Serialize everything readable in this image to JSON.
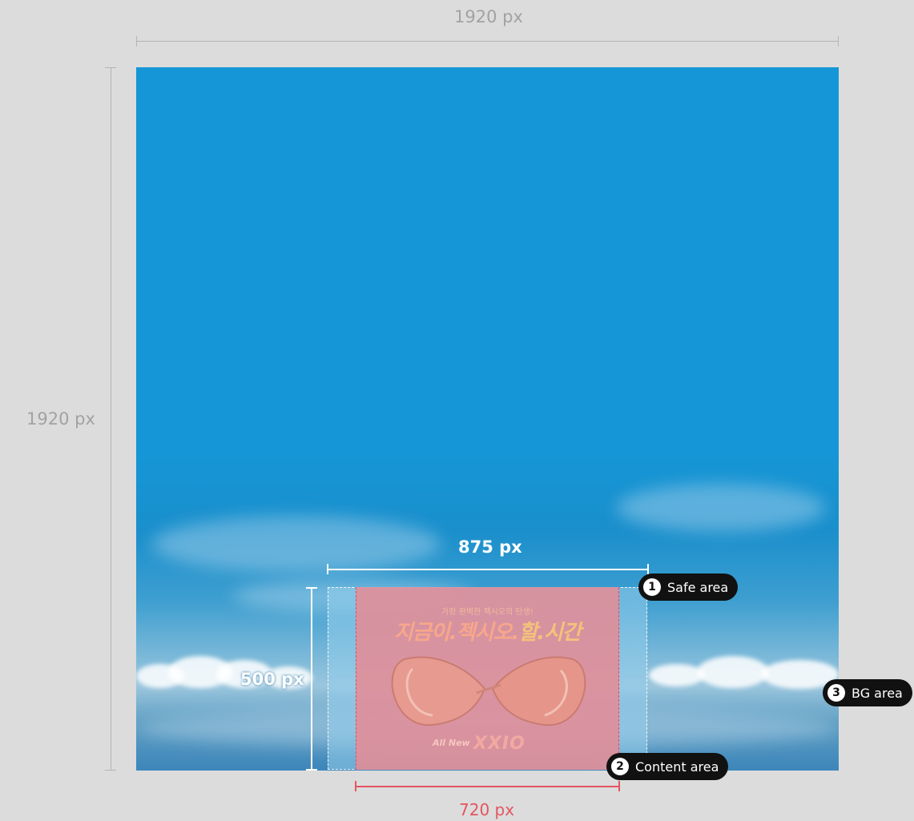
{
  "dimensions": {
    "top_width": "1920 px",
    "left_height": "1920 px",
    "safe_width": "875 px",
    "safe_height": "500 px",
    "content_width": "720 px"
  },
  "callouts": [
    {
      "number": "1",
      "label": "Safe area"
    },
    {
      "number": "2",
      "label": "Content area"
    },
    {
      "number": "3",
      "label": "BG area"
    }
  ],
  "banner": {
    "subtitle": "가장 완벽한 젝시오의 탄생!",
    "title_part1": "지금이.젝시오.",
    "title_accent": "할.시간",
    "brand_small": "All New",
    "brand_logo": "XXIO"
  },
  "colors": {
    "background": "#dcdcdc",
    "sky": "#1597d7",
    "content_overlay": "#e48c96",
    "content_dimension": "#e45560",
    "callout_bg": "#111111"
  }
}
